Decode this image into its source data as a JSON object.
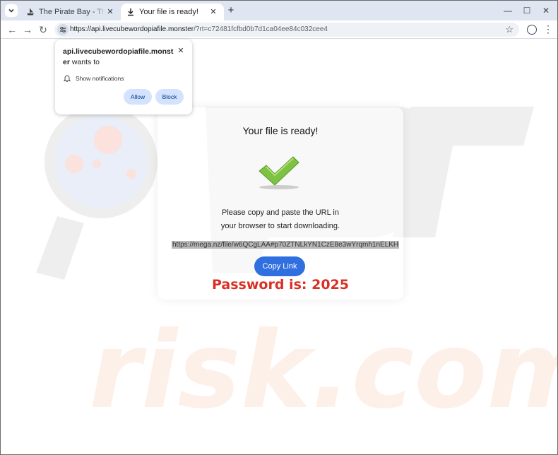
{
  "tabs": [
    {
      "title": "The Pirate Bay - The galaxy's most resilient BitTorrent site",
      "favicon": "pirate-ship-icon",
      "active": false
    },
    {
      "title": "Your file is ready!",
      "favicon": "download-icon",
      "active": true
    }
  ],
  "toolbar": {
    "url_host": "https://api.livecubewordopiafile.monster",
    "url_path": "/?rt=c72481fcfbd0b7d1ca04ee84c032cee4"
  },
  "notification_popup": {
    "host": "api.livecubewordopiafile.monster",
    "wants_to": "wants to",
    "permission": "Show notifications",
    "allow_label": "Allow",
    "block_label": "Block"
  },
  "page": {
    "title": "Your file is ready!",
    "instruction_line1": "Please copy and paste the URL in",
    "instruction_line2": "your browser to start downloading.",
    "download_link": "https://mega.nz/file/w6QCgLAA#p70ZTNLkYN1CzE8e3wYrqmh1nELKH",
    "copy_button": "Copy Link",
    "password_text": "Password is: 2025"
  },
  "watermark": "PC risk.com",
  "colors": {
    "accent": "#2f6fe0",
    "password": "#d93025",
    "check": "#7dc242"
  }
}
